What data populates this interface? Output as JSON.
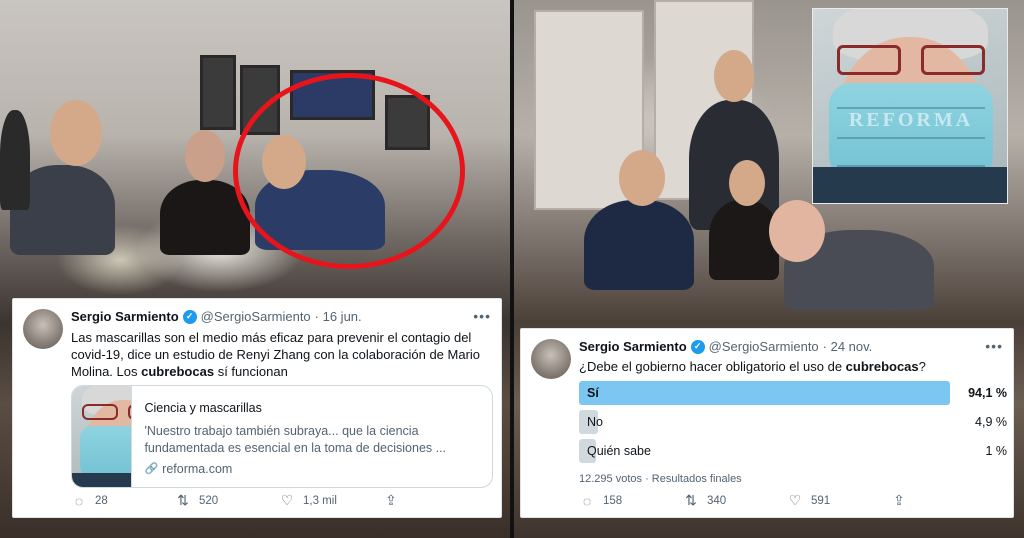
{
  "left": {
    "tweet": {
      "name": "Sergio Sarmiento",
      "handle": "@SergioSarmiento",
      "date": "· 16 jun.",
      "text_part1": "Las mascarillas son el medio más eficaz para prevenir el contagio del covid-19, dice un estudio de Renyi Zhang con la colaboración de Mario Molina. Los ",
      "text_bold": "cubrebocas",
      "text_part2": " sí funcionan",
      "card": {
        "title": "Ciencia y mascarillas",
        "description": "'Nuestro trabajo también subraya... que la ciencia fundamentada es esencial en la toma de decisiones ...",
        "domain": "reforma.com"
      },
      "actions": {
        "replies": "28",
        "retweets": "520",
        "likes": "1,3 mil"
      }
    }
  },
  "right": {
    "inset_watermark": "REFORMA",
    "tweet": {
      "name": "Sergio Sarmiento",
      "handle": "@SergioSarmiento",
      "date": "· 24 nov.",
      "question_part1": "¿Debe el gobierno hacer obligatorio el uso de ",
      "question_bold": "cubrebocas",
      "question_part2": "?",
      "poll": [
        {
          "label": "Sí",
          "percent_text": "94,1 %",
          "percent": 94.1
        },
        {
          "label": "No",
          "percent_text": "4,9 %",
          "percent": 4.9
        },
        {
          "label": "Quién sabe",
          "percent_text": "1 %",
          "percent": 1
        }
      ],
      "votes": "12.295 votos",
      "status": "Resultados finales",
      "actions": {
        "replies": "158",
        "retweets": "340",
        "likes": "591"
      }
    }
  },
  "colors": {
    "highlight_ring": "#e8141b",
    "poll_winner": "#7cc6f2",
    "poll_other": "#cfd9de",
    "verified": "#1d9bf0"
  }
}
